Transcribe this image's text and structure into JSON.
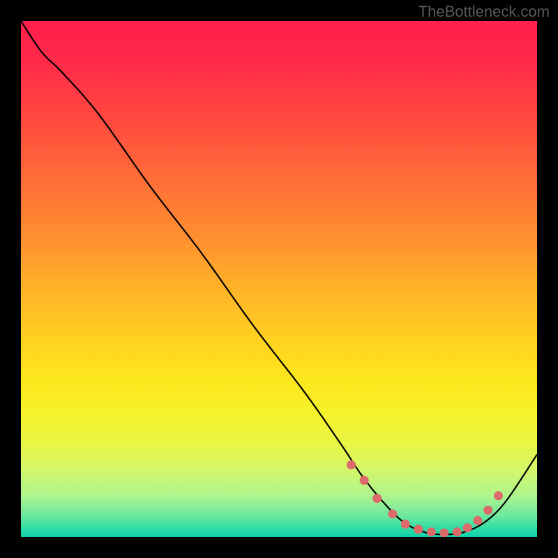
{
  "attribution": "TheBottleneck.com",
  "chart_data": {
    "type": "line",
    "title": "",
    "xlabel": "",
    "ylabel": "",
    "xlim": [
      0,
      100
    ],
    "ylim": [
      0,
      100
    ],
    "series": [
      {
        "name": "curve",
        "x": [
          0,
          4,
          8,
          15,
          25,
          35,
          45,
          55,
          62,
          66,
          70,
          74,
          78,
          82,
          86,
          90,
          94,
          100
        ],
        "y": [
          100,
          94,
          90,
          82,
          68,
          55,
          41,
          28,
          18,
          12,
          7,
          3,
          1,
          0.5,
          1,
          3,
          7,
          16
        ]
      }
    ],
    "markers": {
      "name": "dots",
      "color": "#dd6a6a",
      "x": [
        64,
        66.5,
        69,
        72,
        74.5,
        77,
        79.5,
        82,
        84.5,
        86.5,
        88.5,
        90.5,
        92.5
      ],
      "y": [
        14,
        11,
        7.5,
        4.5,
        2.5,
        1.5,
        1,
        0.8,
        1,
        1.8,
        3.2,
        5.2,
        8
      ]
    }
  }
}
